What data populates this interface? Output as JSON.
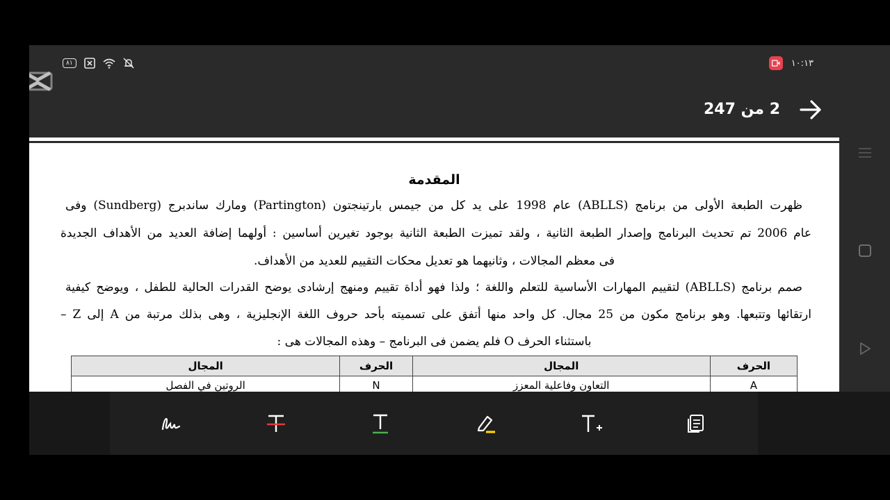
{
  "status_bar": {
    "battery": "٨١",
    "time": "١٠:١٣"
  },
  "header": {
    "page_indicator": "2 من 247"
  },
  "document": {
    "title": "المقدمة",
    "lines": [
      "ظهرت الطبعة الأولى من برنامج (ABLLS) عام 1998 على يد كل من جيمس بارتينجتون (Partington) ومارك ساندبرج (Sundberg) وفى",
      "عام 2006 تم تحديث البرنامج وإصدار الطبعة الثانية ، ولقد تميزت الطبعة الثانية بوجود تغيرين أساسين : أولهما إضافة العديد من الأهداف الجديدة",
      "فى معظم المجالات ، وثانيهما هو تعديل محكات التقييم للعديد من الأهداف.",
      "صمم برنامج (ABLLS) لتقييم المهارات الأساسية للتعلم واللغة ؛ ولذا فهو أداة تقييم ومنهج إرشادى يوضح القدرات الحالية للطفل ، ويوضح كيفية",
      "ارتقائها وتتبعها. وهو برنامج مكون من 25 مجال. كل واحد منها أتفق على تسميته بأحد حروف اللغة الإنجليزية ، وهى بذلك مرتبة من  A إلى Z –",
      "باستثناء الحرف O فلم يضمن فى البرنامج – وهذه المجالات هى :"
    ],
    "table": {
      "headers": [
        "الحرف",
        "المجال",
        "الحرف",
        "المجال"
      ],
      "rows": [
        [
          "A",
          "التعاون وفاعلية المعزز",
          "N",
          "الروتين في الفصل"
        ]
      ]
    }
  },
  "toolbar": {
    "tools": [
      "signature-tool",
      "strikethrough-tool",
      "underline-tool",
      "highlight-tool",
      "add-text-tool",
      "pages-tool"
    ]
  },
  "colors": {
    "record_indicator": "#e8424f",
    "strike_red": "#e53935",
    "underline_green": "#4caf50",
    "highlight_yellow": "#ffd600"
  }
}
